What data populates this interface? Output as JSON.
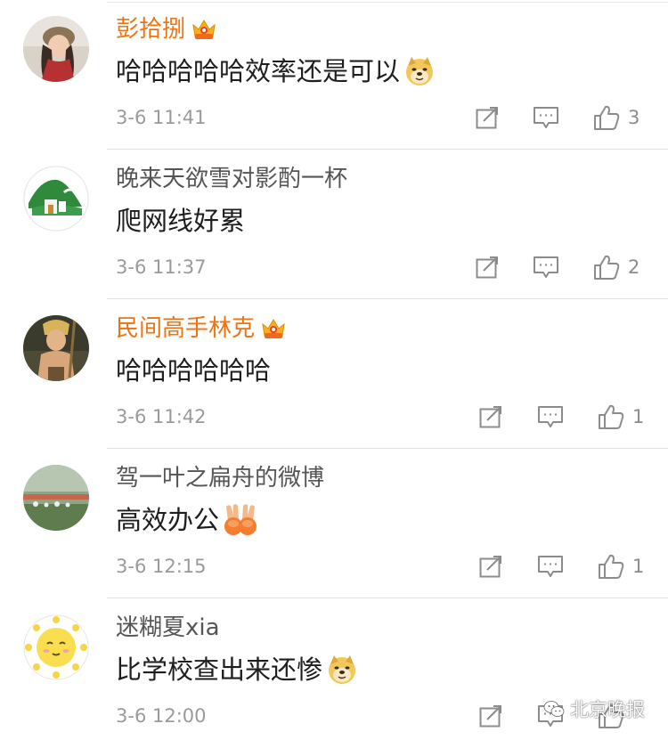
{
  "comments": [
    {
      "username": "彭拾捌",
      "vip": true,
      "content": "哈哈哈哈哈效率还是可以",
      "content_emoji": "doge-emoji",
      "time": "3-6 11:41",
      "likes": "3",
      "avatar": "woman-hat-avatar"
    },
    {
      "username": "晚来天欲雪对影酌一杯",
      "vip": false,
      "content": "爬网线好累",
      "content_emoji": "",
      "time": "3-6 11:37",
      "likes": "2",
      "avatar": "green-landscape-avatar"
    },
    {
      "username": "民间高手林克",
      "vip": true,
      "content": "哈哈哈哈哈哈",
      "content_emoji": "",
      "time": "3-6 11:42",
      "likes": "1",
      "avatar": "game-character-avatar"
    },
    {
      "username": "驾一叶之扁舟的微博",
      "vip": false,
      "content": "高效办公",
      "content_emoji": "victory-hands-emoji",
      "time": "3-6 12:15",
      "likes": "1",
      "avatar": "raindrop-rail-avatar"
    },
    {
      "username": "迷糊夏xia",
      "vip": false,
      "content": "比学校查出来还惨",
      "content_emoji": "doge-emoji",
      "time": "3-6 12:00",
      "likes": "",
      "avatar": "sun-face-avatar"
    }
  ],
  "icons": {
    "repost": "repost-icon",
    "reply": "reply-icon",
    "like": "thumbs-up-icon",
    "crown": "vip-crown-icon"
  },
  "colors": {
    "vip_name": "#f0730f",
    "normal_name": "#555555",
    "meta": "#9a9a9a"
  },
  "watermark": {
    "text": "北京晚报",
    "icon": "wechat-icon"
  }
}
